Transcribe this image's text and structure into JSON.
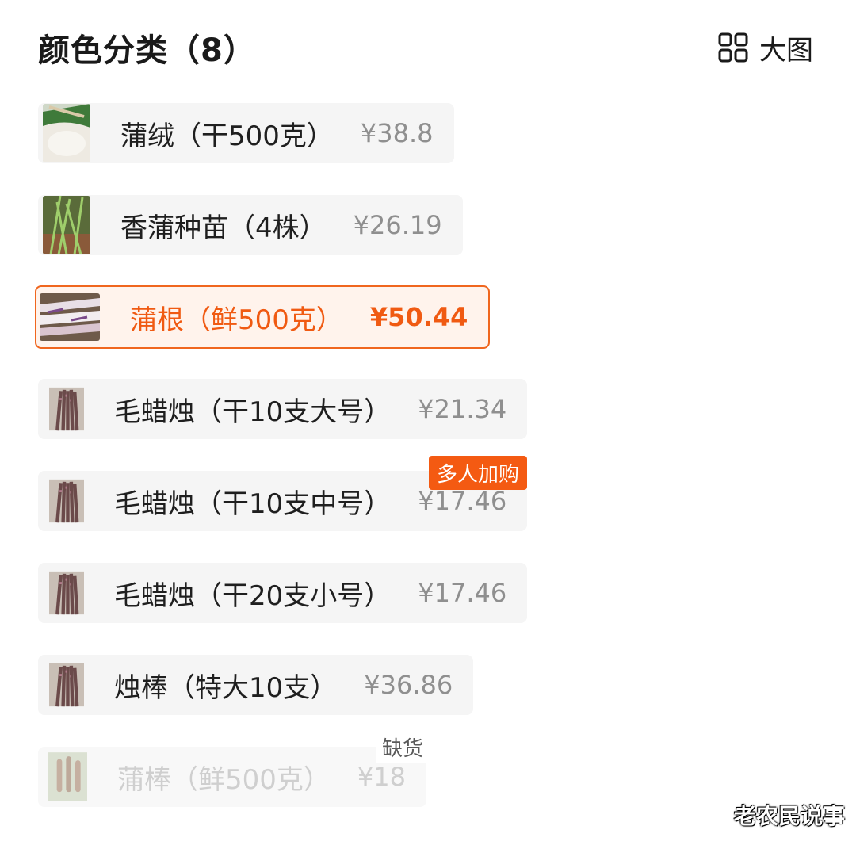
{
  "header": {
    "title": "颜色分类（8）",
    "view_toggle_label": "大图",
    "view_toggle_icon": "grid-icon"
  },
  "options": [
    {
      "name": "蒲绒（干500克）",
      "price": "¥38.8",
      "state": "normal"
    },
    {
      "name": "香蒲种苗（4株）",
      "price": "¥26.19",
      "state": "normal"
    },
    {
      "name": "蒲根（鲜500克）",
      "price": "¥50.44",
      "state": "selected"
    },
    {
      "name": "毛蜡烛（干10支大号）",
      "price": "¥21.34",
      "state": "normal"
    },
    {
      "name": "毛蜡烛（干10支中号）",
      "price": "¥17.46",
      "state": "normal",
      "tag": "多人加购"
    },
    {
      "name": "毛蜡烛（干20支小号）",
      "price": "¥17.46",
      "state": "normal"
    },
    {
      "name": "烛棒（特大10支）",
      "price": "¥36.86",
      "state": "normal"
    },
    {
      "name": "蒲棒（鲜500克）",
      "price": "¥18",
      "state": "disabled",
      "tag": "缺货"
    }
  ],
  "colors": {
    "accent": "#f05a12",
    "selected_bg": "#fff3ec",
    "option_bg": "#f5f5f5",
    "price_gray": "#8f8f8f"
  },
  "watermark": "老农民说事"
}
